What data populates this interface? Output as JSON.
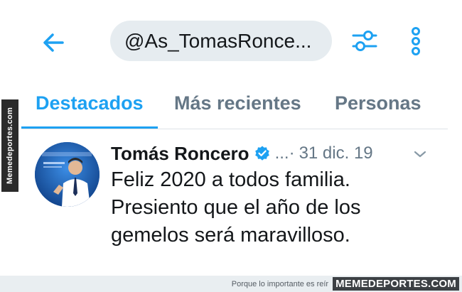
{
  "search": {
    "query": "@As_TomasRonce..."
  },
  "tabs": [
    {
      "label": "Destacados",
      "active": true
    },
    {
      "label": "Más recientes",
      "active": false
    },
    {
      "label": "Personas",
      "active": false
    }
  ],
  "tweet": {
    "author_name": "Tomás Roncero",
    "handle_truncated": "...·",
    "date": "31 dic. 19",
    "text_lines": [
      "Feliz 2020 a todos familia.",
      "Presiento que el año de los",
      "gemelos será maravilloso."
    ]
  },
  "watermark": {
    "side_label": "Memedeportes.com",
    "tagline": "Porque lo importante es reír",
    "brand": "MEMEDEPORTES.COM"
  },
  "colors": {
    "accent": "#1da1f2",
    "secondary_text": "#657786",
    "search_bg": "#e6ecf0",
    "verified": "#1da1f2"
  },
  "icons": [
    "back-arrow-icon",
    "filter-sliders-icon",
    "more-vertical-icon",
    "verified-badge-icon",
    "chevron-down-icon"
  ]
}
